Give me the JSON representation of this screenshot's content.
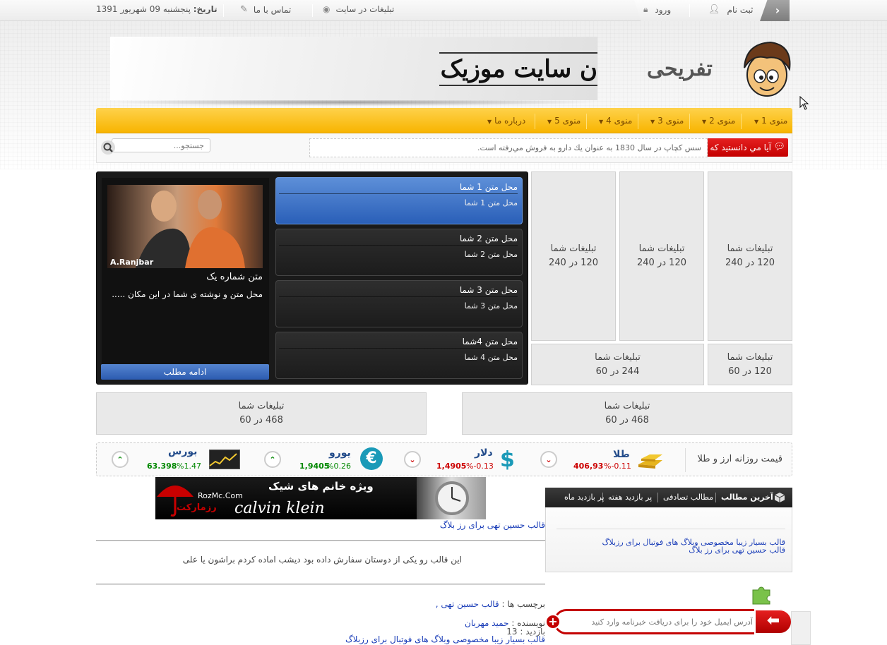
{
  "topbar": {
    "date_label": "تاریخ:",
    "date_value": "پنجشنبه 09 شهریور 1391",
    "contact": "تماس با ما",
    "ads": "تبلیغات در سایت",
    "login": "ورود",
    "register": "ثبت نام"
  },
  "banner": {
    "text": "ن سایت موزیک"
  },
  "logo": {
    "text": "تفریحی"
  },
  "menu": {
    "items": [
      "منوی 1",
      "منوی 2",
      "منوی 3",
      "منوی 4",
      "منوی 5",
      "درباره ما"
    ]
  },
  "subbar": {
    "didyou": "آیا مي دانستيد كه",
    "ticker": "سس كچاپ در سال 1830 به عنوان يك دارو به فروش مي‌رفته است.",
    "search_placeholder": "جستجو..."
  },
  "ads": {
    "a1_title": "تبليغات شما",
    "a1_size": "120 در 240",
    "a2_title": "تبليغات شما",
    "a2_size": "120 در 240",
    "a3_title": "تبليغات شما",
    "a3_size": "120 در 240",
    "a4_title": "تبليغات شما",
    "a4_size": "120 در 60",
    "a5_title": "تبليغات شما",
    "a5_size": "244 در 60",
    "a6_title": "تبليغات شما",
    "a6_size": "468 در 60",
    "a7_title": "تبليغات شما",
    "a7_size": "468 در 60"
  },
  "slider": {
    "items": [
      {
        "title": "محل متن 1 شما",
        "desc": "محل متن 1 شما"
      },
      {
        "title": "محل متن 2 شما",
        "desc": "محل متن 2 شما"
      },
      {
        "title": "محل متن 3 شما",
        "desc": "محل متن 3 شما"
      },
      {
        "title": "محل متن 4شما",
        "desc": "محل متن 4 شما"
      }
    ],
    "feature_title": "متن شماره یک",
    "feature_desc": "محل متن و نوشته ی شما در این مکان .....",
    "photo_caption": "A.Ranjbar",
    "more": "ادامه مطلب"
  },
  "currency": {
    "label": "قیمت روزانه ارز و طلا",
    "gold": {
      "name": "طلا",
      "change": "%-0.11",
      "value": "406,93"
    },
    "dollar": {
      "name": "دلار",
      "change": "%-0.13",
      "value": "1,4905"
    },
    "euro": {
      "name": "یورو",
      "change": "%0.26",
      "value": "1,9405"
    },
    "bourse": {
      "name": "بورس",
      "change": "%1.47",
      "value": "63.398"
    }
  },
  "calvin": {
    "title": "ویژه خانم های شیک",
    "brand": "calvin klein",
    "site": "RozMc.Com",
    "name": "رزمارکت"
  },
  "post": {
    "link": "قالب حسین تهی برای رز بلاگ",
    "text": "این قالب رو یکی از دوستان سفارش داده بود دیشب اماده کردم براشون  یا علی",
    "tags_label": "برچسب ها :",
    "tags_value": "قالب حسین تهی ,",
    "author_label": "نویسنده :",
    "author_value": "حمید مهربان",
    "visits_label": "بازدید :",
    "visits_value": "13",
    "next_link": "قالب بسیار زیبا مخصوصی وبلاگ های فوتبال برای رزبلاگ"
  },
  "sidebar": {
    "tabs": [
      "آخرین مطالب",
      "مطالب تصادفی",
      "پر بازدید هفته",
      "پر بازدید ماه"
    ],
    "links": [
      "قالب بسیار زیبا مخصوصی وبلاگ های فوتبال برای رزبلاگ",
      "قالب حسین تهی برای رز بلاگ"
    ]
  },
  "newsletter": {
    "placeholder": "آدرس ایمیل خود را برای دریافت خبرنامه وارد کنید"
  },
  "colors": {
    "menu": "#f8b400",
    "active": "#2a5fb8",
    "red": "#c40000"
  }
}
